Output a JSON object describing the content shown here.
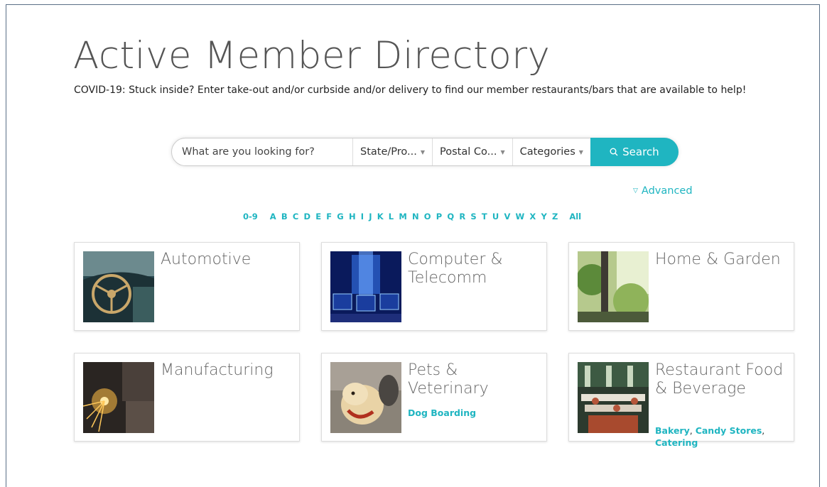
{
  "page": {
    "title": "Active Member Directory",
    "notice": "COVID-19: Stuck inside? Enter take-out and/or curbside and/or delivery to find our member restaurants/bars that are available to help!"
  },
  "search": {
    "placeholder": "What are you looking for?",
    "state_label": "State/Pro...",
    "postal_label": "Postal Co...",
    "categories_label": "Categories",
    "button_label": "Search",
    "advanced_label": "Advanced"
  },
  "alphabet": [
    "0-9",
    "A",
    "B",
    "C",
    "D",
    "E",
    "F",
    "G",
    "H",
    "I",
    "J",
    "K",
    "L",
    "M",
    "N",
    "O",
    "P",
    "Q",
    "R",
    "S",
    "T",
    "U",
    "V",
    "W",
    "X",
    "Y",
    "Z",
    "All"
  ],
  "categories": [
    {
      "title": "Automotive",
      "links": []
    },
    {
      "title": "Computer & Telecomm",
      "links": []
    },
    {
      "title": "Home & Garden",
      "links": []
    },
    {
      "title": "Manufacturing",
      "links": []
    },
    {
      "title": "Pets & Veterinary",
      "links": [
        "Dog Boarding"
      ]
    },
    {
      "title": "Restaurant Food & Beverage",
      "links": [
        "Bakery",
        "Candy Stores",
        "Catering"
      ]
    }
  ],
  "colors": {
    "accent": "#1fb5c1",
    "title": "#555555"
  }
}
